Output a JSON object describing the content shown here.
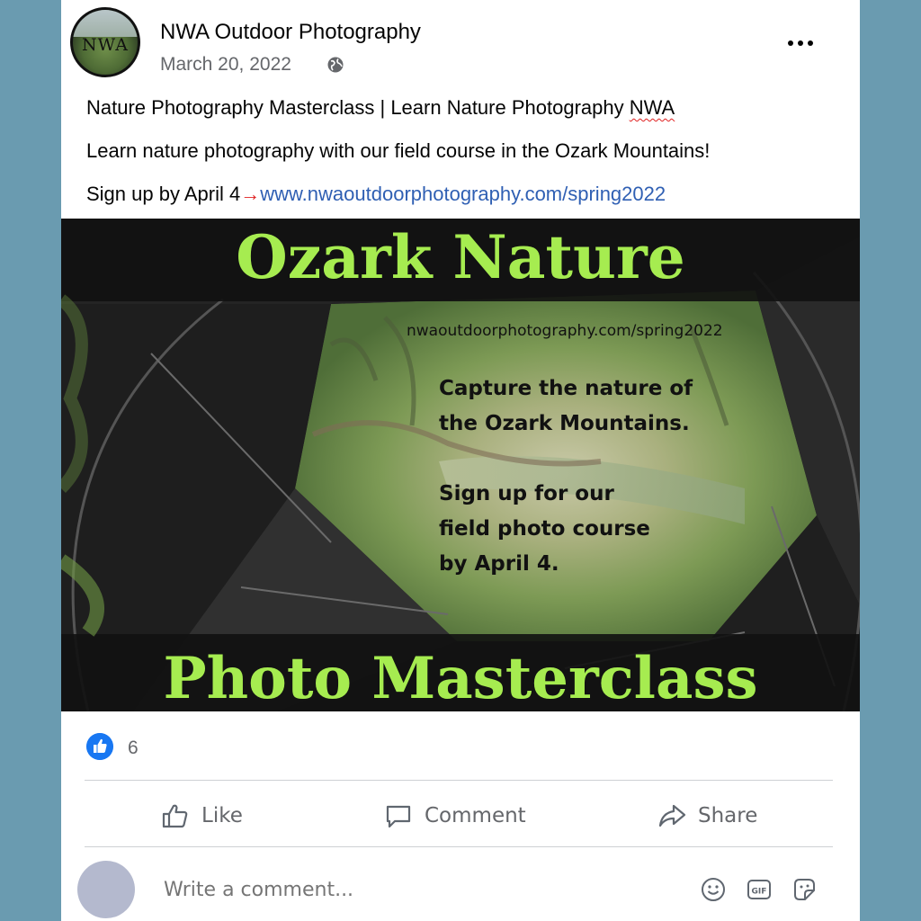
{
  "post": {
    "page_name": "NWA Outdoor Photography",
    "avatar_text": "NWA",
    "date": "March 20, 2022",
    "privacy_icon": "globe-icon",
    "menu_icon": "more-options-icon",
    "line1": "Nature Photography Masterclass | Learn Nature Photography ",
    "line1_tail": "NWA",
    "line2": "Learn nature photography with our field course in the Ozark Mountains!",
    "line3_prefix": "Sign up by April 4",
    "line3_arrow": "→",
    "link": "www.nwaoutdoorphotography.com/spring2022"
  },
  "banner": {
    "title": "Ozark Nature",
    "url": "nwaoutdoorphotography.com/spring2022",
    "body1": [
      "Capture the nature of",
      "the Ozark Mountains."
    ],
    "body2": [
      "Sign up for our",
      "field photo course",
      "by April 4."
    ],
    "subtitle": "Photo Masterclass",
    "accent_color": "#a6ec50"
  },
  "reactions": {
    "count": "6",
    "icon": "like-badge-icon"
  },
  "actions": {
    "like": "Like",
    "comment": "Comment",
    "share": "Share"
  },
  "comment_box": {
    "placeholder": "Write a comment...",
    "icons": [
      "emoji-icon",
      "gif-icon",
      "sticker-icon"
    ]
  },
  "colors": {
    "background": "#6a9bb0",
    "link": "#2f5fb3",
    "like_blue": "#1877f2"
  }
}
